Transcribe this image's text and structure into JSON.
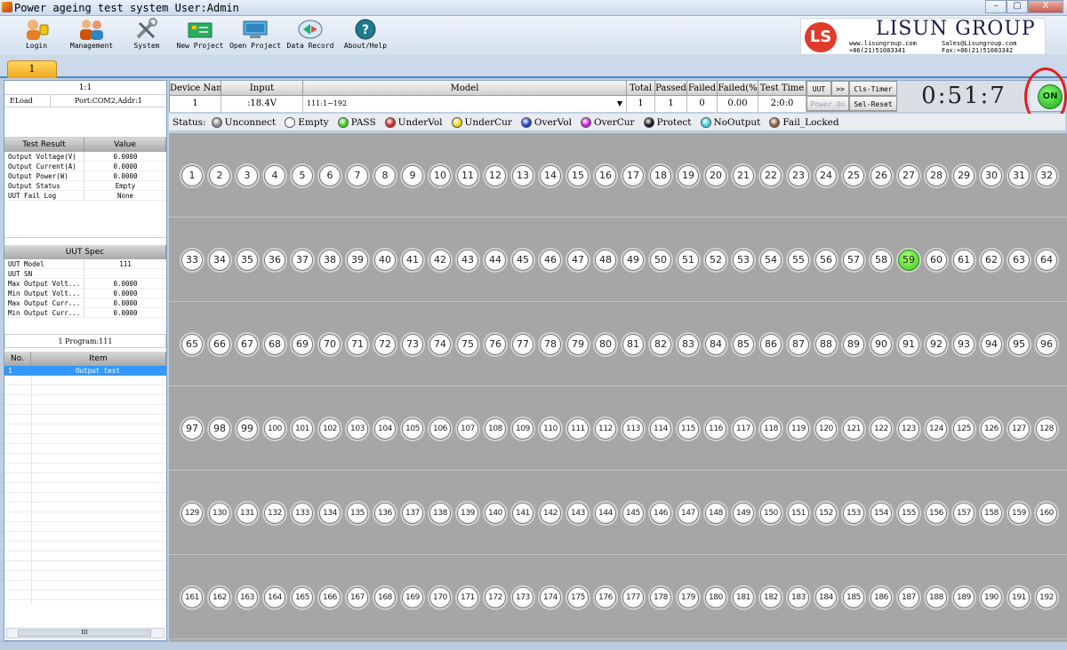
{
  "window": {
    "title": "Power ageing test system  User:Admin",
    "buttons": [
      "–",
      "▢",
      "X"
    ]
  },
  "toolbar": {
    "items": [
      {
        "label": "Login",
        "icon": "login-icon"
      },
      {
        "label": "Management",
        "icon": "users-icon"
      },
      {
        "label": "System",
        "icon": "tools-icon"
      },
      {
        "label": "New Project",
        "icon": "new-project-icon"
      },
      {
        "label": "Open Project",
        "icon": "open-project-icon"
      },
      {
        "label": "Data Record",
        "icon": "data-record-icon"
      },
      {
        "label": "About/Help",
        "icon": "help-icon"
      }
    ]
  },
  "logo": {
    "mark": "LS",
    "brand": "LISUN GROUP",
    "web": "www.lisungroup.com",
    "phone": "+86(21)51083341",
    "email": "Sales@Lisungroup.com",
    "fax": "Fax:+86(21)51083342"
  },
  "tabs": [
    "1"
  ],
  "left": {
    "ratio": "1:1",
    "eload_label": "ELoad",
    "port": "Port:COM2,Addr:1",
    "result_header": {
      "col1": "Test Result",
      "col2": "Value"
    },
    "results": [
      {
        "k": "Output Voltage(V)",
        "v": "0.0000"
      },
      {
        "k": "Output Current(A)",
        "v": "0.0000"
      },
      {
        "k": "Output Power(W)",
        "v": "0.0000"
      },
      {
        "k": "Output Status",
        "v": "Empty"
      },
      {
        "k": "UUT Fail Log",
        "v": "None"
      }
    ],
    "spec_header": "UUT Spec",
    "spec": [
      {
        "k": "UUT Model",
        "v": "111"
      },
      {
        "k": "UUT SN",
        "v": ""
      },
      {
        "k": "Max Output Volt...",
        "v": "0.0000"
      },
      {
        "k": "Min Output Volt...",
        "v": "0.0000"
      },
      {
        "k": "Max Output Curr...",
        "v": "0.0000"
      },
      {
        "k": "Min Output Curr...",
        "v": "0.0000"
      }
    ],
    "program_title": "1  Program:111",
    "program_header": {
      "col1": "No.",
      "col2": "Item"
    },
    "program_rows": [
      {
        "n": "1",
        "item": "Output test"
      }
    ],
    "hscroll_label": "III"
  },
  "info": {
    "headers": {
      "device": "Device Nam",
      "input": "Input",
      "model": "Model",
      "total": "Total",
      "passed": "Passed",
      "failed": "Failed",
      "failed_pct": "Failed(%",
      "test_time": "Test Time"
    },
    "values": {
      "device": "1",
      "input": ":18.4V",
      "model": "111:1~192",
      "total": "1",
      "passed": "1",
      "failed": "0",
      "failed_pct": "0.00",
      "test_time": "2:0:0"
    },
    "buttons": {
      "uut": "UUT",
      "next": ">>",
      "cls_timer": "Cls-Timer",
      "power_on": "Power On",
      "sel_reset": "Sel-Reset"
    },
    "timer": "0:51:7",
    "on_label": "ON"
  },
  "status_legend": {
    "label": "Status:",
    "items": [
      {
        "name": "Unconnect",
        "color": "#8a8a8a"
      },
      {
        "name": "Empty",
        "color": "#ffffff"
      },
      {
        "name": "PASS",
        "color": "#3ed11a"
      },
      {
        "name": "UnderVol",
        "color": "#e01e1e"
      },
      {
        "name": "UnderCur",
        "color": "#f5d311"
      },
      {
        "name": "OverVol",
        "color": "#1f3fc9"
      },
      {
        "name": "OverCur",
        "color": "#c61ed8"
      },
      {
        "name": "Protect",
        "color": "#111111"
      },
      {
        "name": "NoOutput",
        "color": "#3bd0e6"
      },
      {
        "name": "Fail_Locked",
        "color": "#8b5a3c"
      }
    ]
  },
  "channels": {
    "count": 192,
    "per_row": 32,
    "pass": [
      59
    ]
  }
}
